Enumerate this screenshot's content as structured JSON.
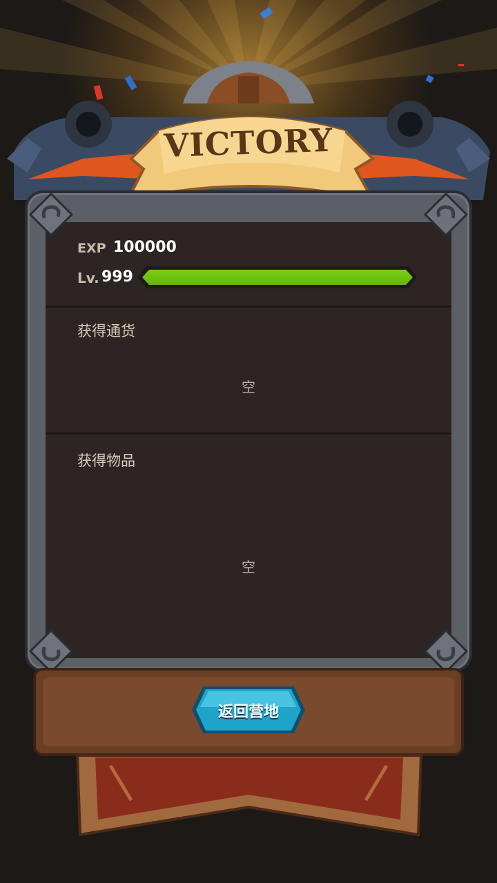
{
  "banner": {
    "title": "VICTORY"
  },
  "exp": {
    "label": "EXP",
    "value": "100000"
  },
  "level": {
    "label": "Lv.",
    "value": "999",
    "progress": 1.0,
    "bar_color": "#7ccf14"
  },
  "currency": {
    "title": "获得通货",
    "empty": "空"
  },
  "items": {
    "title": "获得物品",
    "empty": "空"
  },
  "footer": {
    "return_button": "返回营地",
    "button_color": "#1fa3c9"
  },
  "colors": {
    "background": "#1e1b18",
    "panel": "#2c2523",
    "frame": "#5b5f66",
    "ribbon_red": "#e0561f",
    "banner_parchment": "#f2c97a"
  }
}
